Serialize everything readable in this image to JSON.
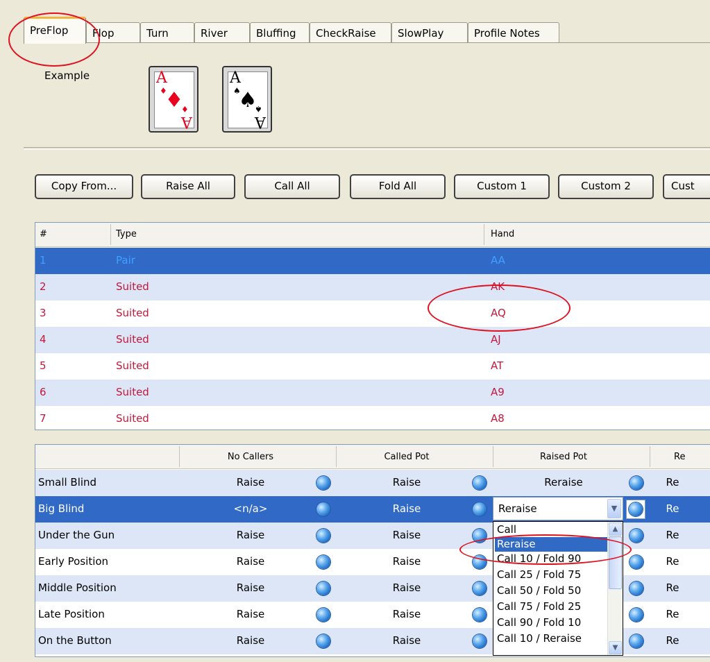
{
  "tabs": [
    {
      "label": "PreFlop",
      "active": true
    },
    {
      "label": "Flop"
    },
    {
      "label": "Turn"
    },
    {
      "label": "River"
    },
    {
      "label": "Bluffing"
    },
    {
      "label": "CheckRaise"
    },
    {
      "label": "SlowPlay"
    },
    {
      "label": "Profile Notes"
    }
  ],
  "example": {
    "label": "Example",
    "cards": [
      {
        "rank": "A",
        "suit": "♦",
        "color": "#e8001c"
      },
      {
        "rank": "A",
        "suit": "♠",
        "color": "#000000"
      }
    ]
  },
  "buttons": [
    "Copy From...",
    "Raise All",
    "Call All",
    "Fold All",
    "Custom 1",
    "Custom 2",
    "Cust"
  ],
  "hands_table": {
    "headers": [
      "#",
      "Type",
      "Hand"
    ],
    "rows": [
      {
        "num": "1",
        "type": "Pair",
        "hand": "AA",
        "selected": true
      },
      {
        "num": "2",
        "type": "Suited",
        "hand": "AK"
      },
      {
        "num": "3",
        "type": "Suited",
        "hand": "AQ"
      },
      {
        "num": "4",
        "type": "Suited",
        "hand": "AJ"
      },
      {
        "num": "5",
        "type": "Suited",
        "hand": "AT"
      },
      {
        "num": "6",
        "type": "Suited",
        "hand": "A9"
      },
      {
        "num": "7",
        "type": "Suited",
        "hand": "A8"
      }
    ]
  },
  "actions_grid": {
    "headers": [
      "No Callers",
      "Called Pot",
      "Raised Pot",
      "Re"
    ],
    "rows": [
      {
        "position": "Small Blind",
        "no_callers": "Raise",
        "called_pot": "Raise",
        "raised_pot": "Reraise",
        "re": "Re"
      },
      {
        "position": "Big Blind",
        "no_callers": "<n/a>",
        "called_pot": "Raise",
        "raised_pot": "",
        "re": "Re",
        "selected": true
      },
      {
        "position": "Under the Gun",
        "no_callers": "Raise",
        "called_pot": "Raise",
        "raised_pot": "",
        "re": "Re"
      },
      {
        "position": "Early Position",
        "no_callers": "Raise",
        "called_pot": "Raise",
        "raised_pot": "",
        "re": "Re"
      },
      {
        "position": "Middle Position",
        "no_callers": "Raise",
        "called_pot": "Raise",
        "raised_pot": "",
        "re": "Re"
      },
      {
        "position": "Late Position",
        "no_callers": "Raise",
        "called_pot": "Raise",
        "raised_pot": "",
        "re": "Re"
      },
      {
        "position": "On the Button",
        "no_callers": "Raise",
        "called_pot": "Raise",
        "raised_pot": "",
        "re": "Re"
      }
    ]
  },
  "dropdown": {
    "selected": "Reraise",
    "options": [
      "Call",
      "Reraise",
      "Call 10 / Fold 90",
      "Call 25 / Fold 75",
      "Call 50 / Fold 50",
      "Call 75 / Fold 25",
      "Call 90 / Fold 10",
      "Call 10 / Reraise"
    ],
    "highlighted_index": 1
  },
  "icons": {
    "combo_arrow": "chevron-down-icon",
    "scroll_up": "chevron-up-icon",
    "scroll_down": "chevron-down-icon",
    "orb": "blue-orb-icon"
  },
  "colors": {
    "selection": "#3169c6",
    "alt_row": "#dde6f6",
    "annotation": "#e0101e",
    "suited_text": "#c2183b"
  }
}
